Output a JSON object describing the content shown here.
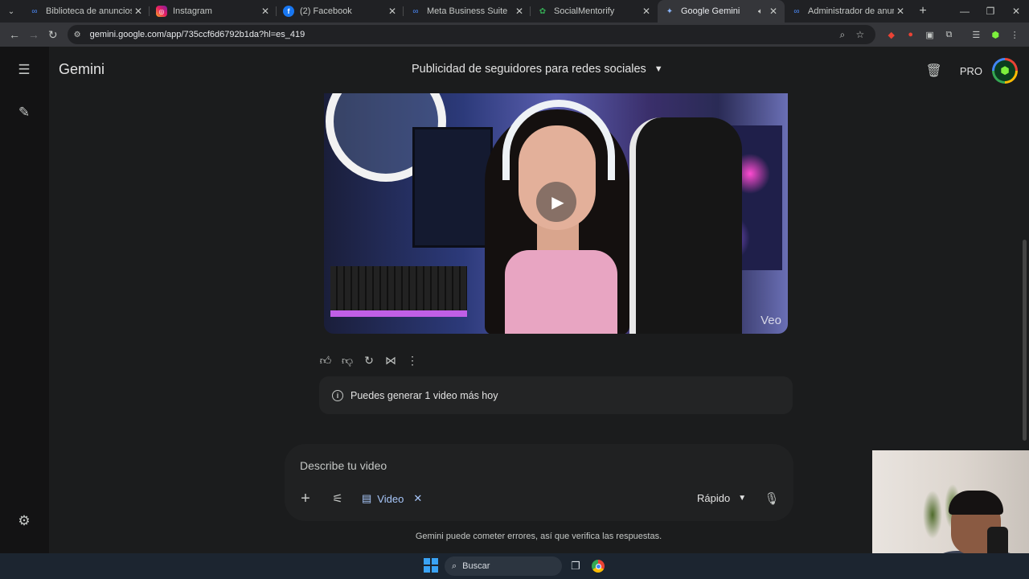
{
  "tabs": [
    {
      "title": "Biblioteca de anuncios",
      "icon": "meta-icon",
      "active": false
    },
    {
      "title": "Instagram",
      "icon": "instagram-icon",
      "active": false
    },
    {
      "title": "(2) Facebook",
      "icon": "facebook-icon",
      "active": false
    },
    {
      "title": "Meta Business Suite",
      "icon": "meta-icon",
      "active": false
    },
    {
      "title": "SocialMentorify",
      "icon": "socialmentorify-icon",
      "active": false
    },
    {
      "title": "Google Gemini",
      "icon": "gemini-icon",
      "active": true
    },
    {
      "title": "Administrador de anuncios - Ad",
      "icon": "meta-icon",
      "active": false
    }
  ],
  "address_bar": {
    "url": "gemini.google.com/app/735ccf6d6792b1da?hl=es_419"
  },
  "app": {
    "brand": "Gemini",
    "conversation_title": "Publicidad de seguidores para redes sociales",
    "plan_badge": "PRO"
  },
  "video": {
    "watermark": "Veo"
  },
  "notice": {
    "text": "Puedes generar 1 video más hoy"
  },
  "composer": {
    "placeholder": "Describe tu video",
    "tool_chip": "Video",
    "mode": "Rápido"
  },
  "disclaimer": "Gemini puede cometer errores, así que verifica las respuestas.",
  "taskbar": {
    "search_label": "Buscar"
  },
  "colors": {
    "accent": "#a8c7fa",
    "background": "#1b1c1d",
    "rail": "#131314"
  }
}
